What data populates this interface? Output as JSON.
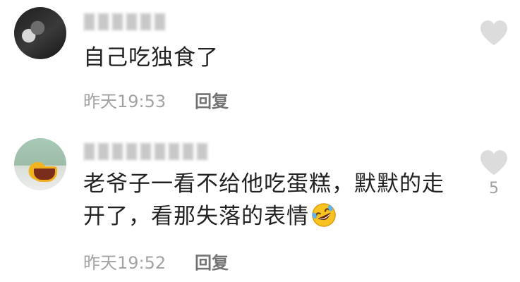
{
  "comments": [
    {
      "text": "自己吃独食了",
      "time": "昨天19:53",
      "reply_label": "回复",
      "likes": ""
    },
    {
      "text_line1": "老爷子一看不给他吃蛋糕，默默的走",
      "text_line2": "开了，看那失落的表情",
      "time": "昨天19:52",
      "reply_label": "回复",
      "likes": "5"
    }
  ],
  "icons": {
    "like": "heart-icon",
    "emoji": "rolling-on-floor-laughing-emoji"
  },
  "colors": {
    "text": "#222222",
    "meta": "#a3a3a3",
    "reply": "#737373",
    "heart": "#dcdcdc"
  }
}
